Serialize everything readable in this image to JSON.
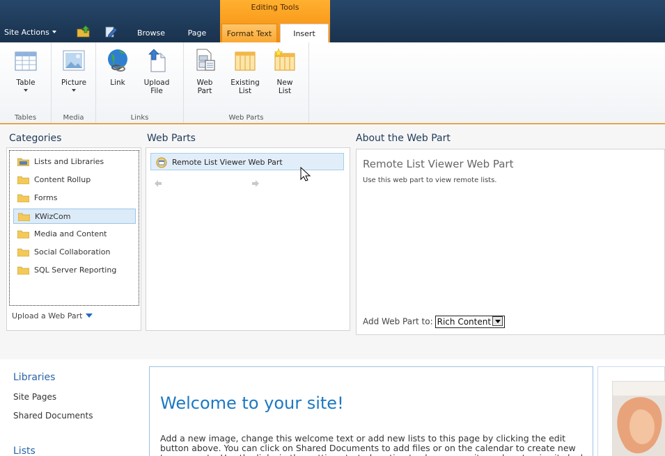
{
  "topbar": {
    "site_actions": "Site Actions",
    "tabs": {
      "browse": "Browse",
      "page": "Page",
      "format_text": "Format Text",
      "insert": "Insert"
    },
    "context_group": "Editing Tools",
    "colors": {
      "bar": "#1f3a58",
      "context": "#f9a326"
    }
  },
  "ribbon": {
    "groups": {
      "tables": "Tables",
      "media": "Media",
      "links": "Links",
      "web_parts": "Web Parts"
    },
    "buttons": {
      "table": "Table",
      "picture": "Picture",
      "link": "Link",
      "upload_file_1": "Upload",
      "upload_file_2": "File",
      "web_part_1": "Web",
      "web_part_2": "Part",
      "existing_list_1": "Existing",
      "existing_list_2": "List",
      "new_list_1": "New",
      "new_list_2": "List"
    }
  },
  "adder": {
    "categories_title": "Categories",
    "webparts_title": "Web Parts",
    "about_title": "About the Web Part",
    "categories": [
      {
        "label": "Lists and Libraries"
      },
      {
        "label": "Content Rollup"
      },
      {
        "label": "Forms"
      },
      {
        "label": "KWizCom"
      },
      {
        "label": "Media and Content"
      },
      {
        "label": "Social Collaboration"
      },
      {
        "label": "SQL Server Reporting"
      }
    ],
    "selected_category": "KWizCom",
    "upload_link": "Upload a Web Part",
    "webpart_item": "Remote List Viewer Web Part",
    "about_name": "Remote List Viewer Web Part",
    "about_description": "Use this web part to view remote lists.",
    "add_to_label": "Add Web Part to:",
    "add_to_value": "Rich Content"
  },
  "page": {
    "quicklaunch": {
      "libraries_head": "Libraries",
      "site_pages": "Site Pages",
      "shared_documents": "Shared Documents",
      "lists_head": "Lists"
    },
    "welcome_title": "Welcome to your site!",
    "welcome_text": "Add a new image, change this welcome text or add new lists to this page by clicking the edit button above. You can click on Shared Documents to add files or on the calendar to create new team events. Use the links in the getting started section to share your site and customize its look."
  }
}
